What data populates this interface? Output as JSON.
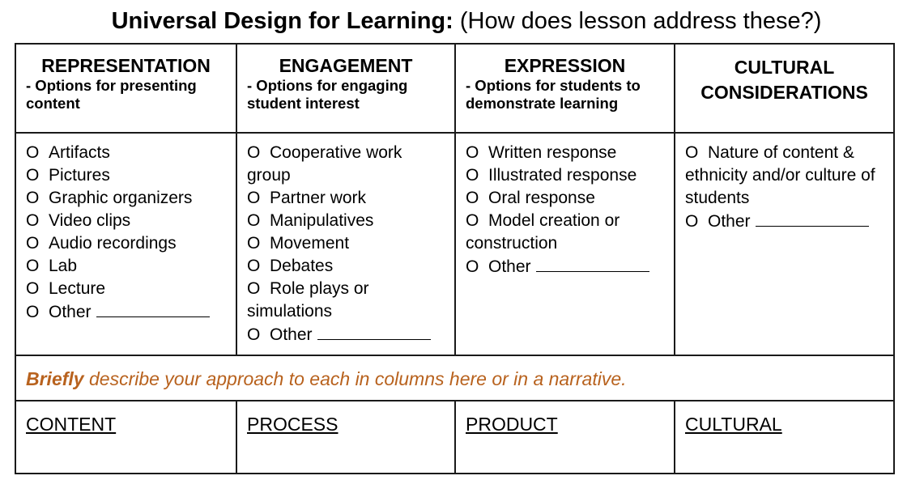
{
  "title": {
    "bold": "Universal Design for Learning:",
    "normal": " (How does lesson address these?)"
  },
  "columns": [
    {
      "heading": "REPRESENTATION",
      "subtitle": "- Options for presenting content",
      "options": [
        "Artifacts",
        "Pictures",
        "Graphic organizers",
        "Video clips",
        "Audio recordings",
        "Lab",
        "Lecture",
        "Other"
      ]
    },
    {
      "heading": "ENGAGEMENT",
      "subtitle": "- Options for engaging student interest",
      "options": [
        "Cooperative work group",
        "Partner work",
        "Manipulatives",
        "Movement",
        "Debates",
        "Role plays or simulations",
        "Other"
      ]
    },
    {
      "heading": "EXPRESSION",
      "subtitle": "- Options for students to demonstrate learning",
      "options": [
        "Written response",
        "Illustrated response",
        "Oral response",
        "Model creation or construction",
        "Other"
      ]
    },
    {
      "heading": "CULTURAL CONSIDERATIONS",
      "subtitle": "",
      "options": [
        "Nature of content & ethnicity and/or culture of students",
        "Other"
      ]
    }
  ],
  "option_marker": "O",
  "narrative": {
    "bold": "Briefly",
    "rest": " describe your approach to each in columns here or in a narrative.",
    "color": "#b8621e"
  },
  "bottom_labels": [
    "CONTENT",
    "PROCESS",
    "PRODUCT",
    "CULTURAL"
  ]
}
